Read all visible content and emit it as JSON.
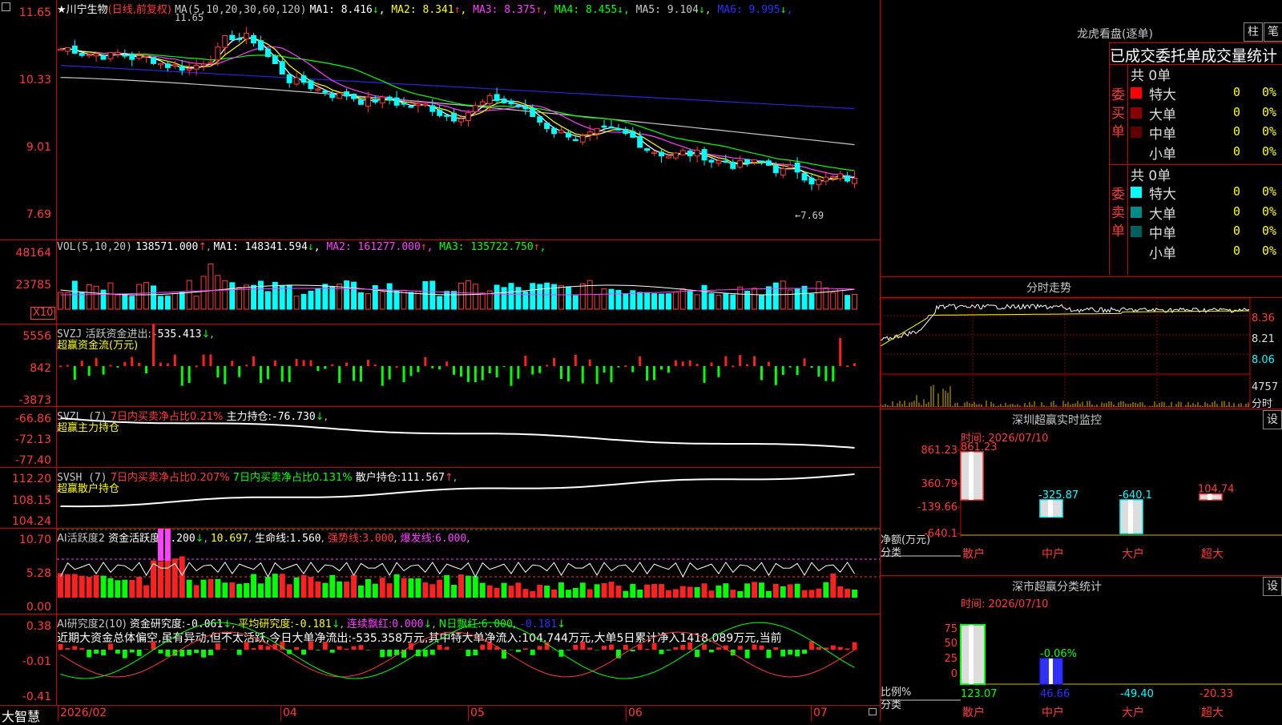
{
  "stock": {
    "name": "★川宁生物",
    "period": "(日线,前复权)",
    "ma_label": "MA(5,10,20,30,60,120)",
    "ma": [
      {
        "label": "MA1:",
        "value": "8.416",
        "arrow": "↓",
        "color": "#ffffff"
      },
      {
        "label": "MA2:",
        "value": "8.341",
        "arrow": "↑",
        "color": "#ffff00"
      },
      {
        "label": "MA3:",
        "value": "8.375",
        "arrow": "↑",
        "color": "#ff40ff"
      },
      {
        "label": "MA4:",
        "value": "8.455",
        "arrow": "↓",
        "color": "#00ff00"
      },
      {
        "label": "MA5:",
        "value": "9.104",
        "arrow": "↓",
        "color": "#c8c8c8"
      },
      {
        "label": "MA6:",
        "value": "9.995",
        "arrow": "↓",
        "color": "#3030ff"
      }
    ],
    "high_label": "11.65",
    "low_label": "←7.69",
    "price_ticks": [
      "11.65",
      "10.33",
      "9.01",
      "7.69"
    ]
  },
  "vol": {
    "label": "VOL(5,10,20)",
    "value": "138571.000",
    "arrow": "↑",
    "ma": [
      {
        "label": "MA1:",
        "value": "148341.594",
        "arrow": "↓",
        "color": "#ffffff"
      },
      {
        "label": "MA2:",
        "value": "161277.000",
        "arrow": "↑",
        "color": "#ff40ff"
      },
      {
        "label": "MA3:",
        "value": "135722.750",
        "arrow": "↑",
        "color": "#00ff00"
      }
    ],
    "ticks": [
      "48164",
      "23785"
    ],
    "unit": "X10"
  },
  "svzj": {
    "label": "SVZJ",
    "text1": "活跃资金进出:",
    "value": "-535.413",
    "arrow": "↓",
    ",": ",",
    "sub": "超赢资金流(万元)",
    "ticks": [
      "5556",
      "842",
      "-3873"
    ]
  },
  "svzl": {
    "label": "SVZL (7)",
    "t1": "7日内买卖净占比0.21%",
    "t2": "主力持仓:",
    "value": "-76.730",
    "arrow": "↓",
    "sub": "超赢主力持仓",
    "ticks": [
      "-66.86",
      "-72.13",
      "-77.40"
    ]
  },
  "svsh": {
    "label": "SVSH (7)",
    "t1": "7日内买卖净占比0.207%",
    "t2": "7日内买卖净占比0.131%",
    "t3": "散户持仓:",
    "value": "111.567",
    "arrow": "↑",
    "sub": "超赢散户持仓",
    "ticks": [
      "112.20",
      "108.15",
      "104.24"
    ]
  },
  "ai1": {
    "label": "AI活跃度2",
    "t1": "资金活跃度:",
    "v1": "1.200",
    "a1": "↓",
    "v2": "10.697",
    "t3": "生命线:",
    "v3": "1.560",
    "t4": "强势线:",
    "v4": "3.000",
    "t5": "爆发线:",
    "v5": "6.000",
    "ticks": [
      "10.70",
      "5.28",
      "0.00"
    ]
  },
  "ai2": {
    "label": "AI研究度2(10)",
    "t1": "资金研究度:",
    "v1": "-0.061",
    "a1": "↓",
    "t2": "平均研究度:",
    "v2": "-0.181",
    "a2": "↓",
    "t3": "连续飘红:",
    "v3": "0.000",
    "a3": "↓",
    "t4": "N日飘红:",
    "v4": "6.000",
    "v5": "-0.181",
    "a5": "↓",
    "comment": "近期大资金总体偏空,虽有异动,但不太活跃,今日大单净流出:-535.358万元,其中特大单净流入:104.744万元,大单5日累计净入1418.089万元,当前",
    "ticks": [
      "0.38",
      "-0.01",
      "-0.41"
    ]
  },
  "xaxis": {
    "labels": [
      "2026/02",
      "04",
      "05",
      "06",
      "07"
    ]
  },
  "brand": "大智慧",
  "longhu": {
    "title": "龙虎看盘(逐单)",
    "btn1": "柱",
    "btn2": "笔",
    "subtitle": "已成交委托单成交量统计",
    "buy": {
      "side": "委买单",
      "total": "共 0单",
      "rows": [
        {
          "label": "特大",
          "v": "0",
          "p": "0%",
          "color": "#ff0000"
        },
        {
          "label": "大单",
          "v": "0",
          "p": "0%",
          "color": "#8b0000"
        },
        {
          "label": "中单",
          "v": "0",
          "p": "0%",
          "color": "#600000"
        },
        {
          "label": "小单",
          "v": "0",
          "p": "0%",
          "color": "#000000"
        }
      ]
    },
    "sell": {
      "side": "委卖单",
      "total": "共 0单",
      "rows": [
        {
          "label": "特大",
          "v": "0",
          "p": "0%",
          "color": "#00ffff"
        },
        {
          "label": "大单",
          "v": "0",
          "p": "0%",
          "color": "#008b8b"
        },
        {
          "label": "中单",
          "v": "0",
          "p": "0%",
          "color": "#006060"
        },
        {
          "label": "小单",
          "v": "0",
          "p": "0%",
          "color": "#000000"
        }
      ]
    }
  },
  "intraday": {
    "title": "分时走势",
    "ticks": [
      "8.36",
      "8.21",
      "8.06"
    ],
    "vol_tick": "4757",
    "vol_unit": "分时"
  },
  "sz_monitor": {
    "title": "深圳超赢实时监控",
    "btn": "设",
    "date_label": "时间: 2026/07/10",
    "ylabel": "净额(万元)",
    "xlabel": "分类",
    "ticks": [
      "861.23",
      "360.79",
      "-139.66",
      "-640.1"
    ],
    "bars": [
      {
        "name": "散户",
        "value": "861.23"
      },
      {
        "name": "中户",
        "value": "-325.87"
      },
      {
        "name": "大户",
        "value": "-640.1"
      },
      {
        "name": "超大",
        "value": "104.74"
      }
    ]
  },
  "sz_class": {
    "title": "深市超赢分类统计",
    "btn": "设",
    "date_label": "时间: 2026/07/10",
    "ylabel": "比例%",
    "xlabel": "分类",
    "ticks": [
      "75",
      "50",
      "25",
      "0"
    ],
    "mid_label": "-0.06%",
    "bars": [
      {
        "name": "散户",
        "value": "123.07",
        "color": "#00ff00"
      },
      {
        "name": "中户",
        "value": "46.66",
        "color": "#3030ff"
      },
      {
        "name": "大户",
        "value": "-49.40",
        "color": "#00ffff"
      },
      {
        "name": "超大",
        "value": "-20.33",
        "color": "#ff3c3c"
      }
    ]
  }
}
